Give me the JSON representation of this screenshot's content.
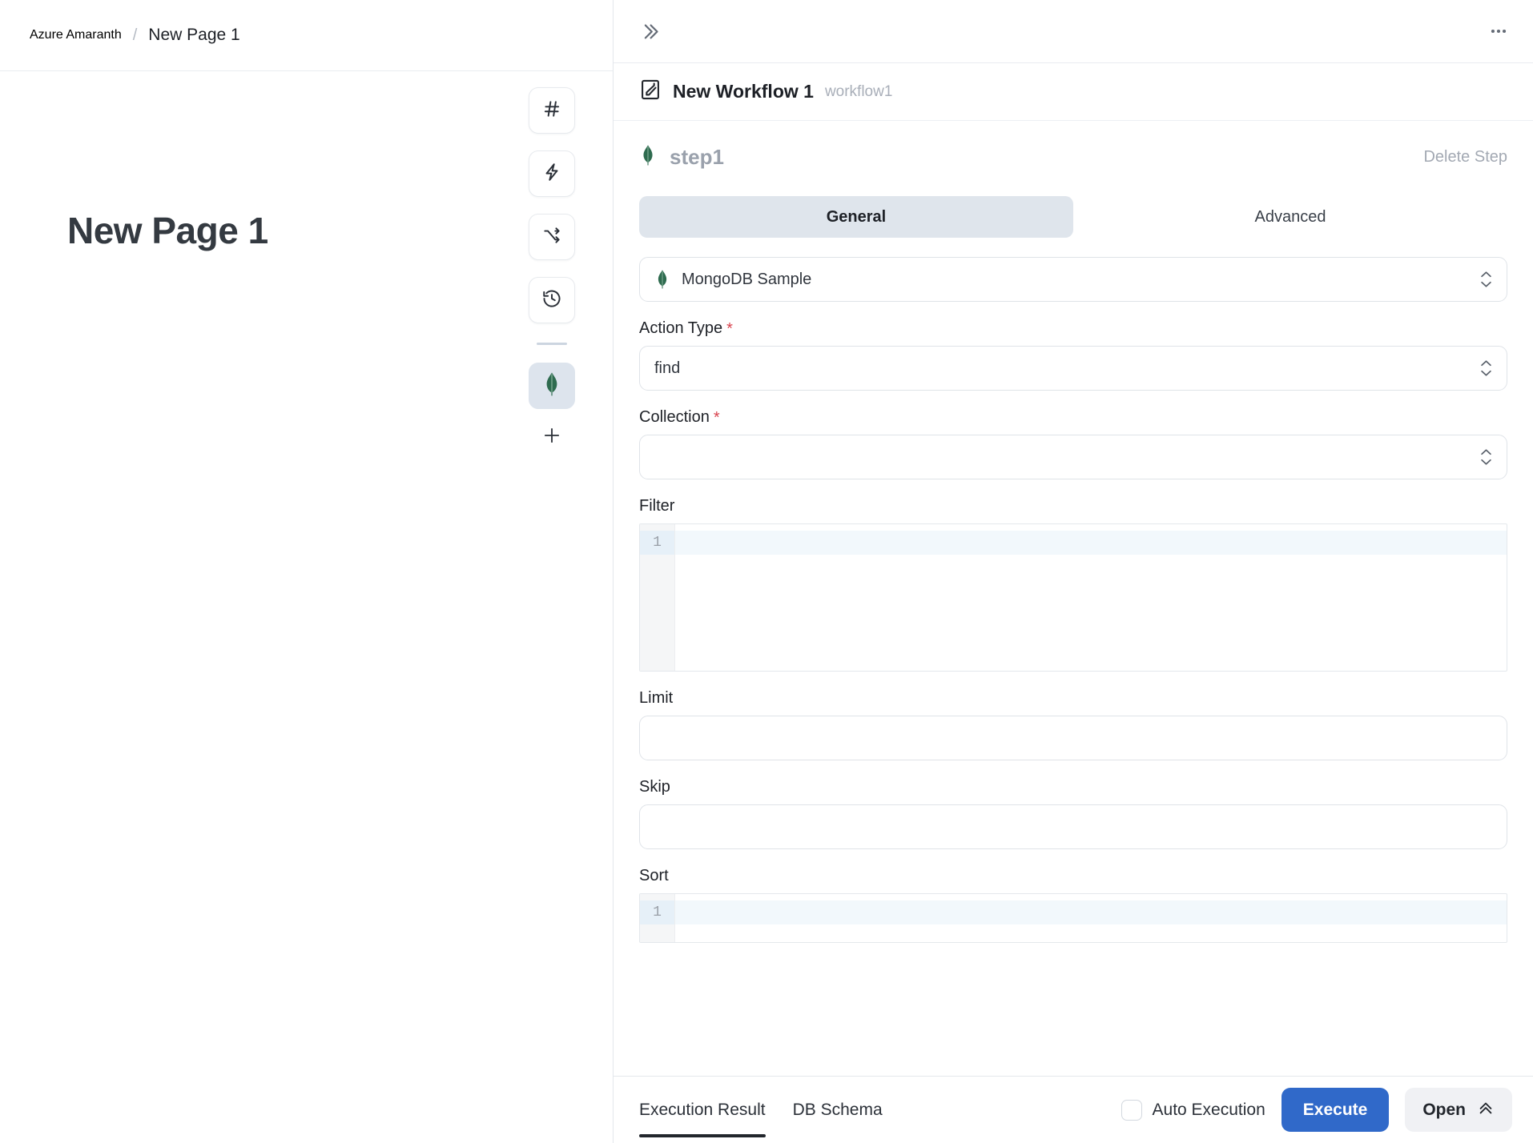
{
  "breadcrumb": {
    "root": "Azure Amaranth",
    "separator": "/",
    "current": "New Page 1"
  },
  "page": {
    "title": "New Page 1"
  },
  "toolbar": {
    "items": [
      {
        "icon": "hash-icon",
        "selected": false
      },
      {
        "icon": "lightning-icon",
        "selected": false
      },
      {
        "icon": "shuffle-icon",
        "selected": false
      },
      {
        "icon": "history-icon",
        "selected": false
      },
      {
        "icon": "mongodb-leaf-icon",
        "selected": true
      }
    ],
    "add_label": "+"
  },
  "right_panel": {
    "expand_icon": "chevrons-right-icon",
    "more_icon": "more-horizontal-icon",
    "workflow": {
      "icon": "workflow-icon",
      "title": "New Workflow 1",
      "id": "workflow1"
    },
    "step": {
      "icon": "mongodb-leaf-icon",
      "name": "step1",
      "delete_label": "Delete Step"
    },
    "tabs": [
      {
        "label": "General",
        "active": true
      },
      {
        "label": "Advanced",
        "active": false
      }
    ],
    "datasource": {
      "icon": "mongodb-leaf-icon",
      "value": "MongoDB Sample"
    },
    "fields": {
      "action_type": {
        "label": "Action Type",
        "required": "*",
        "value": "find"
      },
      "collection": {
        "label": "Collection",
        "required": "*",
        "value": ""
      },
      "filter": {
        "label": "Filter",
        "value": "",
        "line_number": "1"
      },
      "limit": {
        "label": "Limit",
        "value": ""
      },
      "skip": {
        "label": "Skip",
        "value": ""
      },
      "sort": {
        "label": "Sort",
        "value": "",
        "line_number": "1"
      }
    }
  },
  "bottom_bar": {
    "tabs": [
      {
        "label": "Execution Result",
        "active": true
      },
      {
        "label": "DB Schema",
        "active": false
      }
    ],
    "auto_execution_label": "Auto Execution",
    "auto_execution_checked": false,
    "execute_label": "Execute",
    "open_label": "Open",
    "open_icon": "chevrons-up-icon"
  },
  "colors": {
    "accent_blue": "#3069c9",
    "mongo_green": "#2e6b4f",
    "selected_bg": "#dde4ed",
    "required_red": "#d9444f",
    "page_bg": "#eef1f5"
  }
}
